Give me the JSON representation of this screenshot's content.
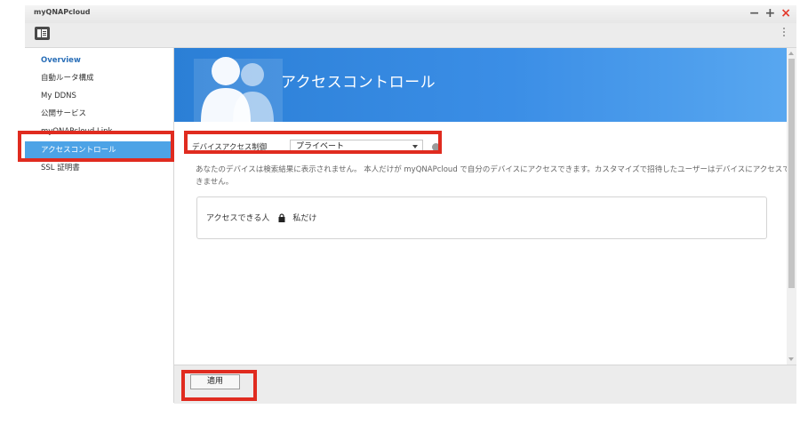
{
  "window": {
    "app_title": "myQNAPcloud",
    "controls": {
      "minimize": "−",
      "maximize": "+",
      "close": "×"
    }
  },
  "sidebar": {
    "items": [
      {
        "label": "Overview"
      },
      {
        "label": "自動ルータ構成"
      },
      {
        "label": "My DDNS"
      },
      {
        "label": "公開サービス"
      },
      {
        "label": "myQNAPcloud Link"
      },
      {
        "label": "アクセスコントロール"
      },
      {
        "label": "SSL 証明書"
      }
    ],
    "active_index": 5
  },
  "banner": {
    "title": "アクセスコントロール",
    "icon": "users-icon"
  },
  "access_control": {
    "label": "デバイスアクセス制御",
    "selected": "プライベート",
    "description": "あなたのデバイスは検索結果に表示されません。 本人だけが myQNAPcloud で自分のデバイスにアクセスできます。カスタマイズで招待したユーザーはデバイスにアクセスできません。",
    "who_label": "アクセスできる人",
    "who_value": "私だけ"
  },
  "footer": {
    "apply_label": "適用"
  },
  "colors": {
    "accent": "#3b8ee6",
    "sidebar_active": "#4da3e6",
    "highlight": "#e02b1f"
  }
}
